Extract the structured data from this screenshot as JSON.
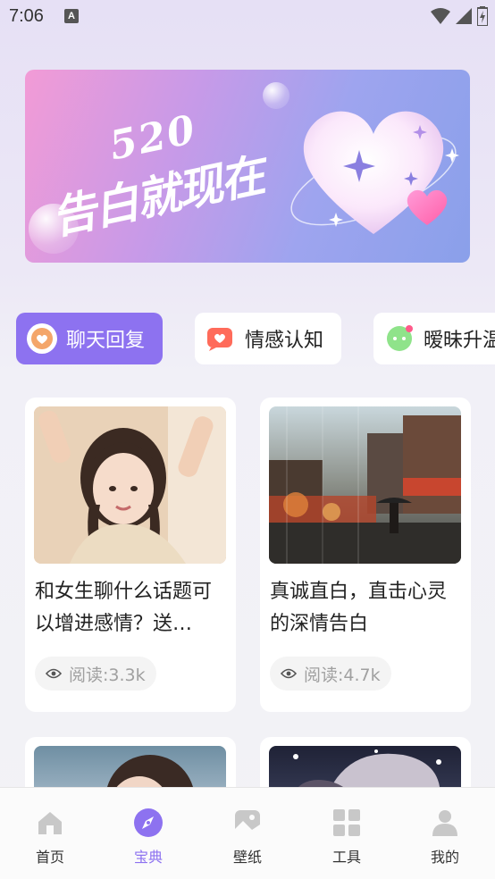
{
  "status_bar": {
    "time": "7:06",
    "notification_icon": "A"
  },
  "banner": {
    "number": "520",
    "title": "告白就现在"
  },
  "categories": [
    {
      "label": "聊天回复",
      "icon": "heart-chat-icon",
      "active": true
    },
    {
      "label": "情感认知",
      "icon": "heart-message-icon",
      "active": false
    },
    {
      "label": "暧昧升温",
      "icon": "green-chat-icon",
      "active": false
    }
  ],
  "articles": [
    {
      "title": "和女生聊什么话题可以增进感情？送…",
      "reads": "阅读:3.3k"
    },
    {
      "title": "真诚直白，直击心灵的深情告白",
      "reads": "阅读:4.7k"
    }
  ],
  "bottom_nav": [
    {
      "label": "首页",
      "icon": "home-icon",
      "active": false
    },
    {
      "label": "宝典",
      "icon": "compass-icon",
      "active": true
    },
    {
      "label": "壁纸",
      "icon": "wallpaper-icon",
      "active": false
    },
    {
      "label": "工具",
      "icon": "grid-icon",
      "active": false
    },
    {
      "label": "我的",
      "icon": "user-icon",
      "active": false
    }
  ],
  "colors": {
    "accent": "#8d72f0",
    "inactive_icon": "#c8c8c8"
  }
}
